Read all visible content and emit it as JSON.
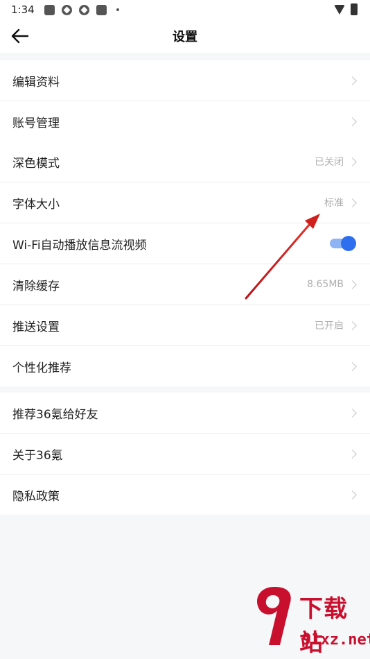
{
  "status_bar": {
    "time": "1:34"
  },
  "header": {
    "title": "设置",
    "back_icon": "arrow-left-icon"
  },
  "groups": [
    {
      "items": [
        {
          "label": "编辑资料",
          "value": "",
          "control": "chevron"
        },
        {
          "label": "账号管理",
          "value": "",
          "control": "chevron"
        }
      ]
    },
    {
      "items": [
        {
          "label": "深色模式",
          "value": "已关闭",
          "control": "chevron"
        },
        {
          "label": "字体大小",
          "value": "标准",
          "control": "chevron"
        },
        {
          "label": "Wi-Fi自动播放信息流视频",
          "value": "",
          "control": "toggle",
          "toggle_on": true
        },
        {
          "label": "清除缓存",
          "value": "8.65MB",
          "control": "chevron"
        },
        {
          "label": "推送设置",
          "value": "已开启",
          "control": "chevron"
        },
        {
          "label": "个性化推荐",
          "value": "",
          "control": "chevron"
        }
      ]
    },
    {
      "items": [
        {
          "label": "推荐36氪给好友",
          "value": "",
          "control": "chevron"
        },
        {
          "label": "关于36氪",
          "value": "",
          "control": "chevron"
        },
        {
          "label": "隐私政策",
          "value": "",
          "control": "chevron"
        }
      ]
    }
  ],
  "colors": {
    "accent": "#2e6ff0",
    "toggle_track": "#8fb4f5",
    "annotation_arrow": "#d0201c",
    "page_bg": "#f6f7f9"
  },
  "watermark": {
    "brand": "下载站",
    "domain": "91xz.net"
  }
}
